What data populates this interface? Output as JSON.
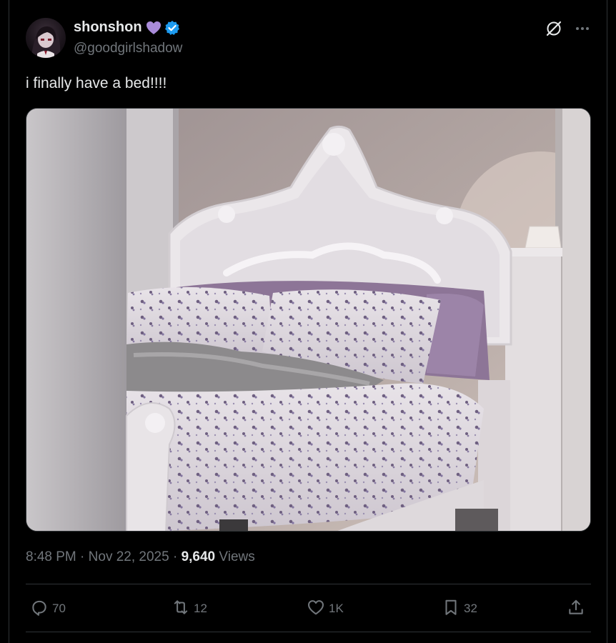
{
  "user": {
    "display_name": "shonshon",
    "handle": "@goodgirlshadow",
    "emoji_icon": "purple-heart-icon",
    "verified_icon": "verified-badge-icon",
    "verified_color": "#1d9bf0"
  },
  "tweet": {
    "text": "i finally have a bed!!!!",
    "time": "8:48 PM",
    "separator": " · ",
    "date": "Nov 22, 2025",
    "views_count": "9,640",
    "views_label": " Views"
  },
  "actions": {
    "replies": "70",
    "reposts": "12",
    "likes": "1K",
    "bookmarks": "32"
  },
  "icons": [
    "grok-icon",
    "more-icon",
    "reply-icon",
    "repost-icon",
    "like-icon",
    "bookmark-icon",
    "share-icon"
  ],
  "colors": {
    "background": "#000000",
    "text": "#e7e9ea",
    "secondary": "#71767b",
    "border": "#2f3336"
  }
}
